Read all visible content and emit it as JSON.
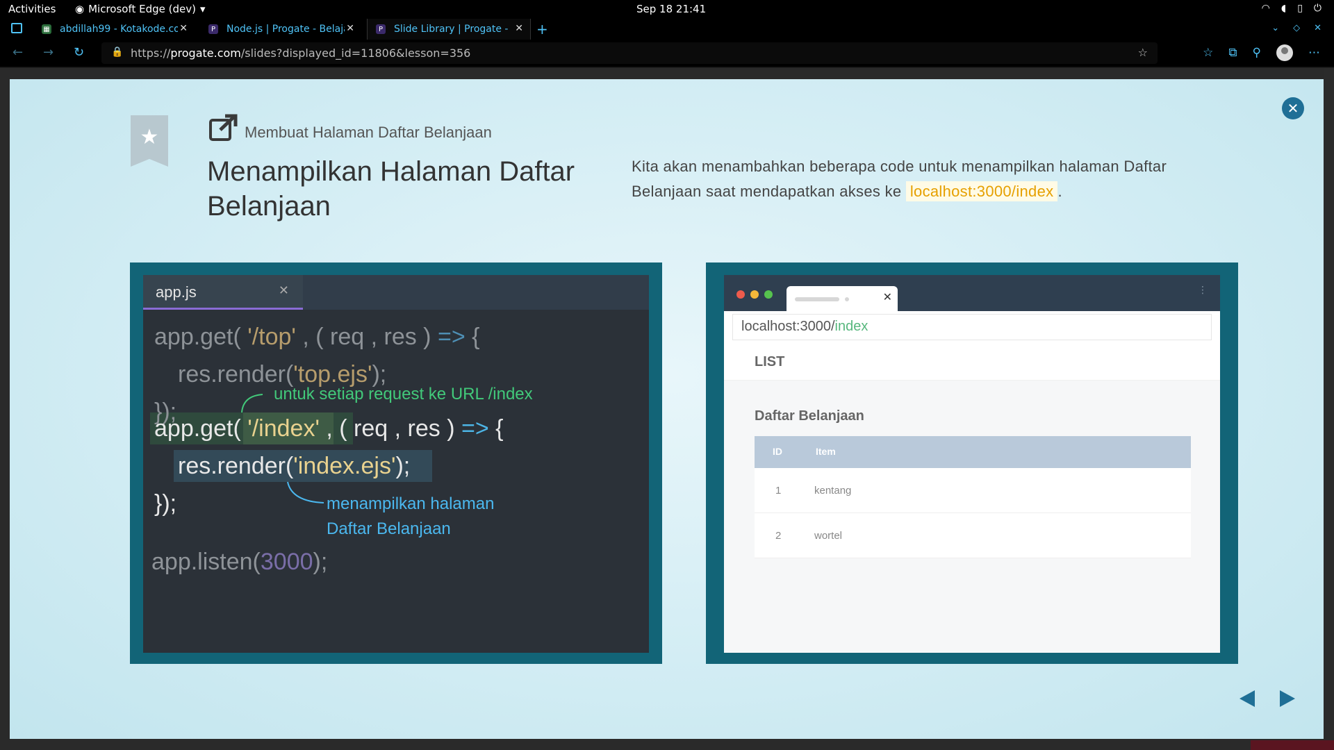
{
  "system": {
    "activities": "Activities",
    "app_name": "Microsoft Edge (dev)",
    "clock": "Sep 18  21:41"
  },
  "tabs": [
    {
      "title": "abdillah99 - Kotakode.co",
      "active": false
    },
    {
      "title": "Node.js | Progate - Belaja",
      "active": false
    },
    {
      "title": "Slide Library | Progate - B",
      "active": true
    }
  ],
  "address": {
    "prefix": "https://",
    "host": "progate.com",
    "path": "/slides?displayed_id=11806&lesson=356"
  },
  "slide": {
    "subtitle": "Membuat Halaman Daftar Belanjaan",
    "title": "Menampilkan Halaman Daftar Belanjaan",
    "desc_before": "Kita akan menambahkan beberapa code untuk menampilkan halaman Daftar Belanjaan saat mendapatkan akses ke ",
    "desc_code": "localhost:3000/index",
    "desc_after": "."
  },
  "editor": {
    "filename": "app.js",
    "lines": {
      "l1_a": "app.get( ",
      "l1_s": "'/top'",
      "l1_b": " , ( req , res ) ",
      "l1_arrow": "=>",
      "l1_c": " {",
      "l2_a": "res.render(",
      "l2_s": "'top.ejs'",
      "l2_b": ");",
      "l3": "});",
      "l4_a": "app.get( ",
      "l4_s": "'/index'",
      "l4_b": " , ( req , res ) ",
      "l4_arrow": "=>",
      "l4_c": " {",
      "l5_a": "res.render(",
      "l5_s": "'index.ejs'",
      "l5_b": ");",
      "l6": "});",
      "l7_a": "app.listen(",
      "l7_n": "3000",
      "l7_b": ");"
    },
    "annotation_green": "untuk setiap request ke URL /index",
    "annotation_blue_1": "menampilkan halaman",
    "annotation_blue_2": "Daftar Belanjaan"
  },
  "mock_browser": {
    "url_host": "localhost:3000/",
    "url_path": "index",
    "nav_label": "LIST",
    "list_title": "Daftar Belanjaan",
    "table": {
      "headers": [
        "ID",
        "Item"
      ],
      "rows": [
        [
          "1",
          "kentang"
        ],
        [
          "2",
          "wortel"
        ]
      ]
    }
  },
  "colors": {
    "accent": "#1f6f96",
    "panel": "#126477",
    "highlight_code": "#e6a000"
  }
}
